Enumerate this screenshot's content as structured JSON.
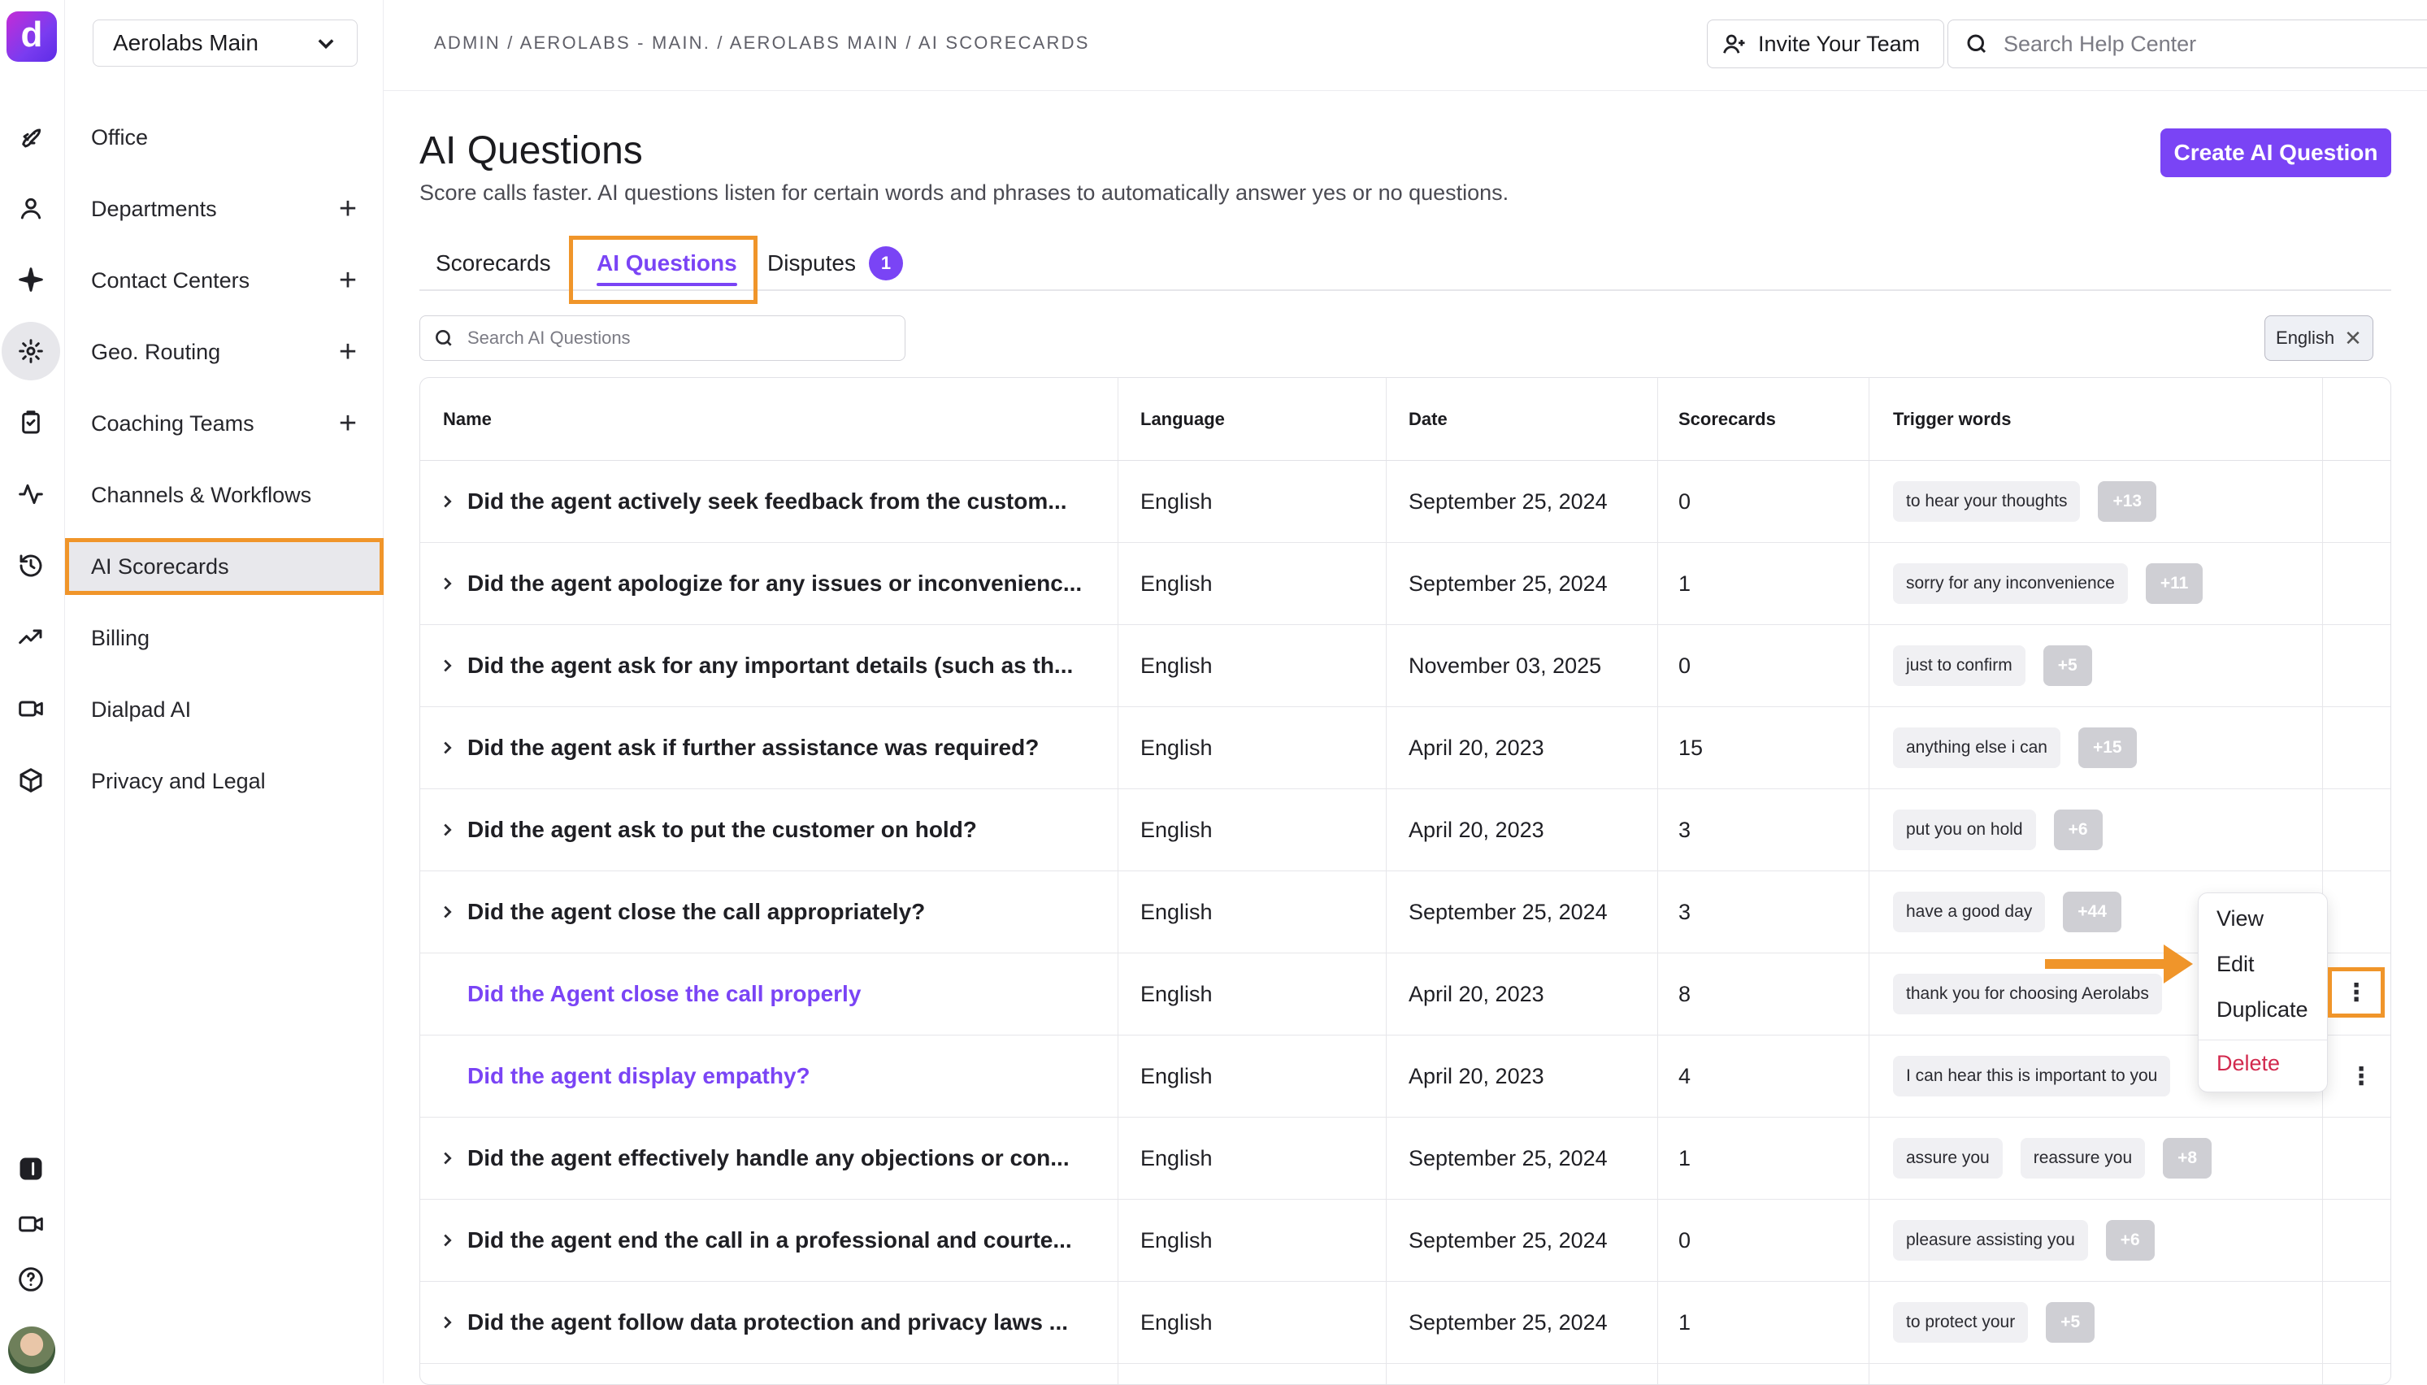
{
  "workspace": {
    "name": "Aerolabs Main"
  },
  "breadcrumb": "ADMIN / AEROLABS - MAIN. / AEROLABS MAIN / AI SCORECARDS",
  "topbar": {
    "invite_label": "Invite Your Team",
    "help_placeholder": "Search Help Center"
  },
  "sidebar": {
    "items": [
      {
        "label": "Office",
        "has_add": false
      },
      {
        "label": "Departments",
        "has_add": true
      },
      {
        "label": "Contact Centers",
        "has_add": true
      },
      {
        "label": "Geo. Routing",
        "has_add": true
      },
      {
        "label": "Coaching Teams",
        "has_add": true
      },
      {
        "label": "Channels & Workflows",
        "has_add": false
      },
      {
        "label": "AI Scorecards",
        "has_add": false,
        "active": true
      },
      {
        "label": "Billing",
        "has_add": false
      },
      {
        "label": "Dialpad AI",
        "has_add": false
      },
      {
        "label": "Privacy and Legal",
        "has_add": false
      }
    ],
    "add_glyph": "+"
  },
  "page": {
    "title": "AI Questions",
    "subtitle": "Score calls faster. AI questions listen for certain words and phrases to automatically answer yes or no questions.",
    "create_label": "Create AI Question"
  },
  "tabs": [
    {
      "label": "Scorecards"
    },
    {
      "label": "AI Questions",
      "active": true
    },
    {
      "label": "Disputes",
      "badge": "1"
    }
  ],
  "search": {
    "placeholder": "Search AI Questions"
  },
  "filter_chip": {
    "label": "English",
    "close": "✕"
  },
  "table": {
    "headers": [
      "Name",
      "Language",
      "Date",
      "Scorecards",
      "Trigger words"
    ],
    "rows": [
      {
        "name": "Did the agent actively seek feedback from the custom...",
        "language": "English",
        "date": "September 25, 2024",
        "scorecards": "0",
        "triggers": [
          "to hear your thoughts"
        ],
        "more": "+13",
        "expandable": true
      },
      {
        "name": "Did the agent apologize for any issues or inconvenienc...",
        "language": "English",
        "date": "September 25, 2024",
        "scorecards": "1",
        "triggers": [
          "sorry for any inconvenience"
        ],
        "more": "+11",
        "expandable": true
      },
      {
        "name": "Did the agent ask for any important details (such as th...",
        "language": "English",
        "date": "November 03, 2025",
        "scorecards": "0",
        "triggers": [
          "just to confirm"
        ],
        "more": "+5",
        "expandable": true
      },
      {
        "name": "Did the agent ask if further assistance was required?",
        "language": "English",
        "date": "April 20, 2023",
        "scorecards": "15",
        "triggers": [
          "anything else i can"
        ],
        "more": "+15",
        "expandable": true
      },
      {
        "name": "Did the agent ask to put the customer on hold?",
        "language": "English",
        "date": "April 20, 2023",
        "scorecards": "3",
        "triggers": [
          "put you on hold"
        ],
        "more": "+6",
        "expandable": true
      },
      {
        "name": "Did the agent close the call appropriately?",
        "language": "English",
        "date": "September 25, 2024",
        "scorecards": "3",
        "triggers": [
          "have a good day"
        ],
        "more": "+44",
        "expandable": true
      },
      {
        "name": "Did the Agent close the call properly",
        "language": "English",
        "date": "April 20, 2023",
        "scorecards": "8",
        "triggers": [
          "thank you for choosing Aerolabs"
        ],
        "more": "",
        "expandable": false,
        "link": true
      },
      {
        "name": "Did the agent display empathy?",
        "language": "English",
        "date": "April 20, 2023",
        "scorecards": "4",
        "triggers": [
          "I can hear this is important to you"
        ],
        "more": "",
        "expandable": false,
        "link": true
      },
      {
        "name": "Did the agent effectively handle any objections or con...",
        "language": "English",
        "date": "September 25, 2024",
        "scorecards": "1",
        "triggers": [
          "assure you",
          "reassure you"
        ],
        "more": "+8",
        "expandable": true
      },
      {
        "name": "Did the agent end the call in a professional and courte...",
        "language": "English",
        "date": "September 25, 2024",
        "scorecards": "0",
        "triggers": [
          "pleasure assisting you"
        ],
        "more": "+6",
        "expandable": true
      },
      {
        "name": "Did the agent follow data protection and privacy laws ...",
        "language": "English",
        "date": "September 25, 2024",
        "scorecards": "1",
        "triggers": [
          "to protect your"
        ],
        "more": "+5",
        "expandable": true
      }
    ]
  },
  "row_menu": {
    "items": [
      "View",
      "Edit",
      "Duplicate",
      "Delete"
    ]
  },
  "kebab_glyph": "⋮",
  "colors": {
    "accent": "#7a44f5",
    "highlight": "#f0952a",
    "danger": "#d2294e"
  }
}
